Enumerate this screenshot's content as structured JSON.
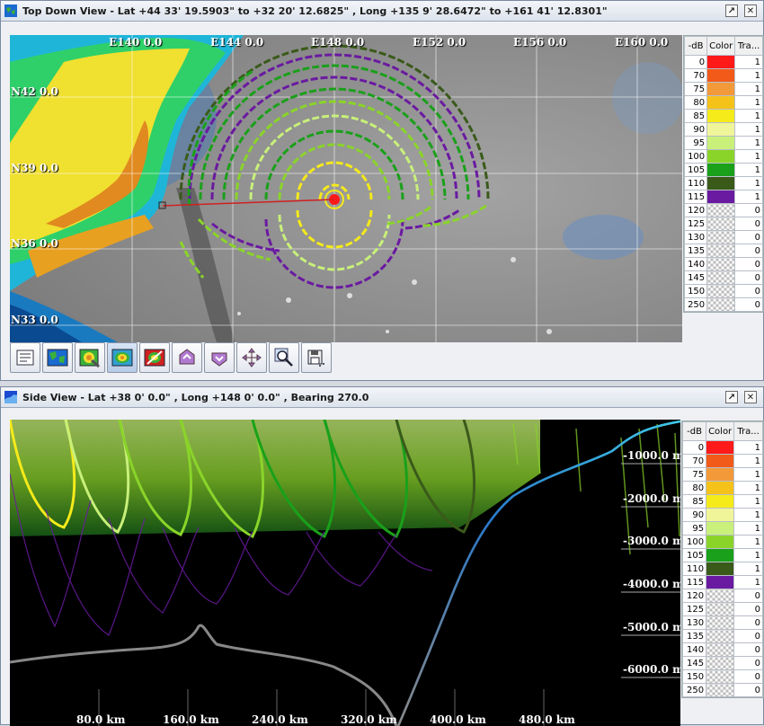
{
  "top": {
    "title": "Top Down View - Lat +44 33' 19.5903\" to +32 20' 12.6825\" ,  Long +135 9' 28.6472\" to +161 41' 12.8301\"",
    "lon_labels": [
      "E140 0.0",
      "E144 0.0",
      "E148 0.0",
      "E152 0.0",
      "E156 0.0",
      "E160 0.0"
    ],
    "lat_labels": [
      "N42 0.0",
      "N39 0.0",
      "N36 0.0",
      "N33 0.0"
    ],
    "toolbar": [
      "properties-icon",
      "map-icon",
      "zoom-map-icon",
      "contour-icon",
      "no-contour-icon",
      "layer-up-icon",
      "layer-down-icon",
      "pan-icon",
      "zoom-icon",
      "save-icon"
    ]
  },
  "side": {
    "title": "Side View - Lat +38 0' 0.0\" , Long +148 0' 0.0\" , Bearing 270.0",
    "depth_labels": [
      "-1000.0 m",
      "-2000.0 m",
      "-3000.0 m",
      "-4000.0 m",
      "-5000.0 m",
      "-6000.0 m"
    ],
    "range_labels": [
      "80.0 km",
      "160.0 km",
      "240.0 km",
      "320.0 km",
      "400.0 km",
      "480.0 km"
    ]
  },
  "legend": {
    "headers": [
      "-dB",
      "Color",
      "Tra..."
    ],
    "rows": [
      {
        "db": "0",
        "color": "#ff1a1a",
        "tra": "1"
      },
      {
        "db": "70",
        "color": "#f25a1a",
        "tra": "1"
      },
      {
        "db": "75",
        "color": "#f29a3a",
        "tra": "1"
      },
      {
        "db": "80",
        "color": "#f5c21a",
        "tra": "1"
      },
      {
        "db": "85",
        "color": "#f5ea1a",
        "tra": "1"
      },
      {
        "db": "90",
        "color": "#f0f59a",
        "tra": "1"
      },
      {
        "db": "95",
        "color": "#c8f07a",
        "tra": "1"
      },
      {
        "db": "100",
        "color": "#8ad42a",
        "tra": "1"
      },
      {
        "db": "105",
        "color": "#1aa01a",
        "tra": "1"
      },
      {
        "db": "110",
        "color": "#3a5a1a",
        "tra": "1"
      },
      {
        "db": "115",
        "color": "#6a1aa0",
        "tra": "1"
      },
      {
        "db": "120",
        "color": "checker",
        "tra": "0"
      },
      {
        "db": "125",
        "color": "checker",
        "tra": "0"
      },
      {
        "db": "130",
        "color": "checker",
        "tra": "0"
      },
      {
        "db": "135",
        "color": "checker",
        "tra": "0"
      },
      {
        "db": "140",
        "color": "checker",
        "tra": "0"
      },
      {
        "db": "145",
        "color": "checker",
        "tra": "0"
      },
      {
        "db": "150",
        "color": "checker",
        "tra": "0"
      },
      {
        "db": "250",
        "color": "checker",
        "tra": "0"
      }
    ]
  }
}
